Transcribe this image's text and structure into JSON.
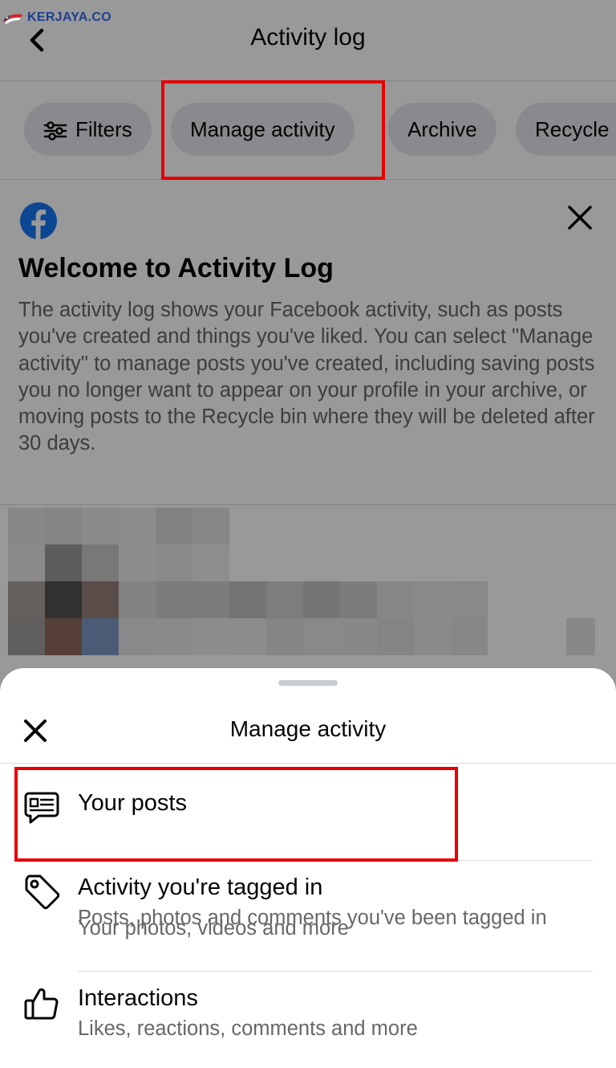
{
  "watermark": {
    "text": "KERJAYA.CO"
  },
  "header": {
    "title": "Activity log",
    "back_icon": "chevron-left-icon"
  },
  "chips": [
    {
      "label": "Filters",
      "icon": "sliders-icon"
    },
    {
      "label": "Manage activity"
    },
    {
      "label": "Archive"
    },
    {
      "label": "Recycle"
    }
  ],
  "welcome": {
    "logo": "facebook-logo",
    "title": "Welcome to Activity Log",
    "body": "The activity log shows your Facebook activity, such as posts you've created and things you've liked. You can select \"Manage activity\" to manage posts you've created, including saving posts you no longer want to appear on your profile in your archive, or moving posts to the Recycle bin where they will be deleted after 30 days."
  },
  "sheet": {
    "title": "Manage activity",
    "items": [
      {
        "title": "Your posts",
        "subtitle": "Your photos, videos and more",
        "icon": "post-bubble-icon"
      },
      {
        "title": "Activity you're tagged in",
        "subtitle": "Posts, photos and comments you've been tagged in",
        "icon": "tag-icon"
      },
      {
        "title": "Interactions",
        "subtitle": "Likes, reactions, comments and more",
        "icon": "thumbs-up-icon"
      }
    ]
  },
  "colors": {
    "highlight": "#e60000",
    "facebook_blue": "#1877f2",
    "chip_bg": "#e4e6eb",
    "secondary_text": "#65676b"
  }
}
